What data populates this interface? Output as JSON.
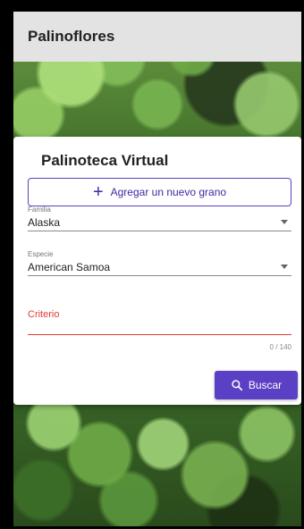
{
  "app": {
    "title": "Palinoflores"
  },
  "card": {
    "title": "Palinoteca Virtual",
    "add_button": {
      "label": "Agregar un nuevo grano",
      "icon": "plus-icon"
    },
    "familia": {
      "label": "Familia",
      "value": "Alaska"
    },
    "especie": {
      "label": "Especie",
      "value": "American Samoa"
    },
    "criterio": {
      "label": "Criterio",
      "value": "",
      "counter": "0 / 140"
    },
    "search_button": {
      "label": "Buscar",
      "icon": "search-icon"
    }
  },
  "colors": {
    "accent": "#5b3fc4",
    "error": "#e53935",
    "appbar": "#e3e3e3"
  }
}
